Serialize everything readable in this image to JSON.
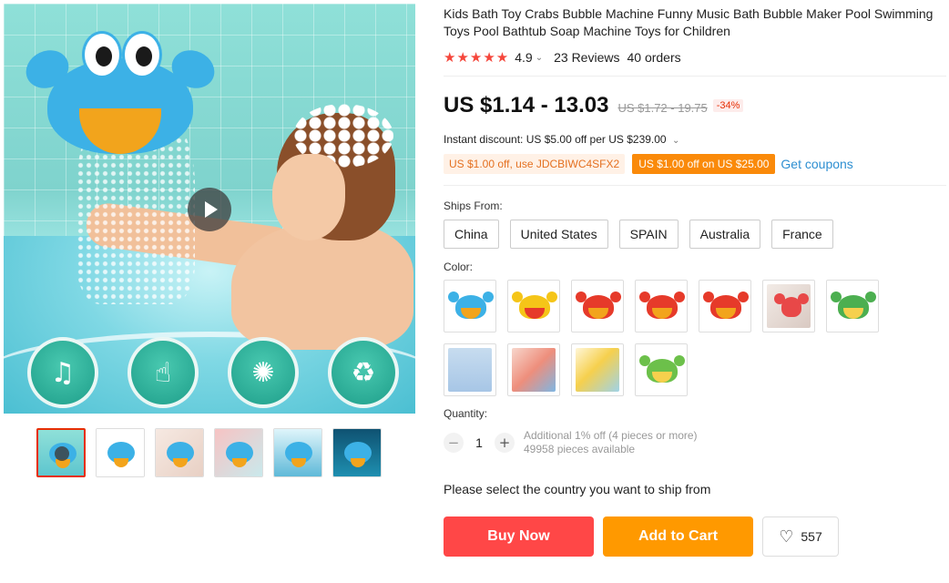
{
  "product": {
    "title": "Kids Bath Toy Crabs Bubble Machine Funny Music Bath Bubble Maker Pool Swimming Toys Pool Bathtub Soap Machine Toys for Children",
    "rating": "4.9",
    "stars": "★★★★★",
    "reviews": "23 Reviews",
    "orders": "40 orders"
  },
  "pricing": {
    "price": "US $1.14 - 13.03",
    "original_price": "US $1.72 - 19.75",
    "discount": "-34%",
    "instant_discount": "Instant discount: US $5.00 off per US $239.00",
    "coupon_code": "US $1.00 off, use JDCBIWC4SFX2",
    "coupon_offer": "US $1.00 off on US $25.00",
    "get_coupons": "Get coupons"
  },
  "ships_from": {
    "label": "Ships From:",
    "options": [
      "China",
      "United States",
      "SPAIN",
      "Australia",
      "France"
    ]
  },
  "color": {
    "label": "Color:",
    "swatches": [
      {
        "icon": "blue-crab-icon",
        "color": "#3cb1e6"
      },
      {
        "icon": "red-yellow-crab-icon",
        "color": "#f5c518"
      },
      {
        "icon": "red-crab-icon",
        "color": "#e63a2a"
      },
      {
        "icon": "red-crab-icon",
        "color": "#e63a2a"
      },
      {
        "icon": "red-crab-icon",
        "color": "#e63a2a"
      },
      {
        "icon": "octopus-photo-icon",
        "color": "#e8e0dc"
      },
      {
        "icon": "green-frog-icon",
        "color": "#4caf50"
      },
      {
        "icon": "duck-bath-photo-icon",
        "color": "#a7c6e6"
      },
      {
        "icon": "bath-toy-set-photo-icon",
        "color": "#ee8e7c"
      },
      {
        "icon": "sunflower-shower-photo-icon",
        "color": "#f6d04d"
      },
      {
        "icon": "green-frog-icon",
        "color": "#6cc04a"
      }
    ]
  },
  "quantity": {
    "label": "Quantity:",
    "value": "1",
    "minus": "−",
    "plus": "+",
    "additional": "Additional 1% off (4 pieces or more)",
    "available": "49958 pieces available"
  },
  "shipping_message": "Please select the country you want to ship from",
  "actions": {
    "buy_now": "Buy Now",
    "add_to_cart": "Add to Cart",
    "wishlist_count": "557"
  },
  "gallery": {
    "features": [
      "music-icon",
      "touch-icon",
      "crab-icon",
      "recycle-icon"
    ],
    "feature_glyphs": [
      "♫",
      "☝",
      "✺",
      "♻"
    ],
    "thumbnails": 6,
    "accent": "#e62e04"
  }
}
